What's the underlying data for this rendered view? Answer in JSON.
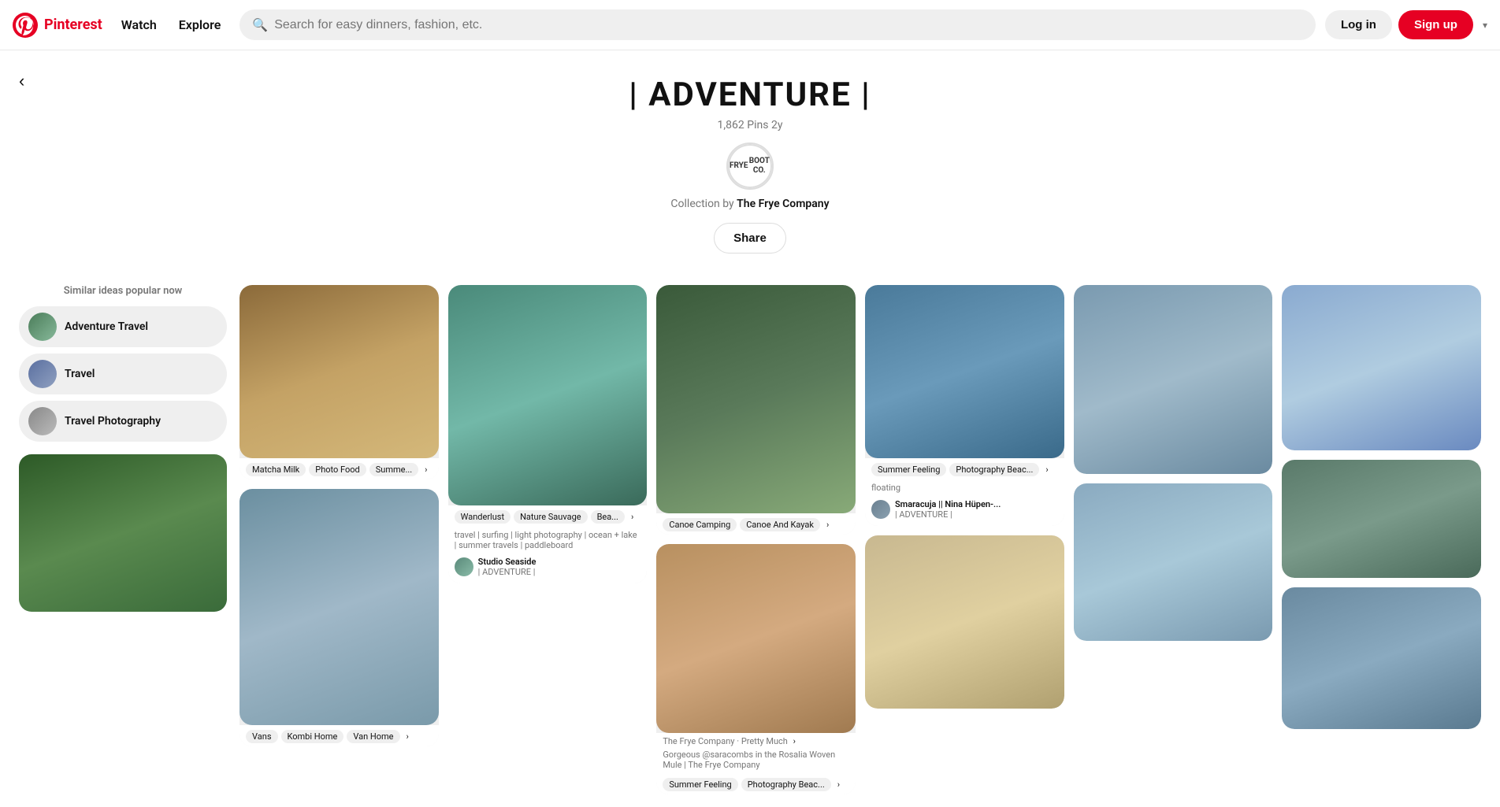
{
  "header": {
    "brand": "Pinterest",
    "nav": [
      {
        "label": "Watch",
        "id": "watch"
      },
      {
        "label": "Explore",
        "id": "explore"
      }
    ],
    "search_placeholder": "Search for easy dinners, fashion, etc.",
    "login_label": "Log in",
    "signup_label": "Sign up"
  },
  "board": {
    "title": "| ADVENTURE |",
    "pins_count": "1,862",
    "pins_label": "Pins",
    "age": "2y",
    "collection_prefix": "Collection by",
    "collection_author": "The Frye Company",
    "share_label": "Share",
    "frye_logo_line1": "FRYE",
    "frye_logo_line2": "BOOT CO."
  },
  "sidebar": {
    "similar_title": "Similar ideas popular now",
    "tags": [
      {
        "label": "Adventure Travel",
        "id": "adventure-travel"
      },
      {
        "label": "Travel",
        "id": "travel"
      },
      {
        "label": "Travel Photography",
        "id": "travel-photography"
      }
    ]
  },
  "pins": [
    {
      "id": "pin-food",
      "style": "ph-food",
      "tags": [
        "Matcha Milk",
        "Photo Food",
        "Summe..."
      ],
      "has_more": true,
      "col": 1
    },
    {
      "id": "pin-van",
      "style": "ph-van",
      "tags": [
        "Vans",
        "Kombi Home",
        "Van Home"
      ],
      "has_more": true,
      "col": 2
    },
    {
      "id": "pin-water",
      "style": "ph-water",
      "tags": [
        "Wanderlust",
        "Nature Sauvage",
        "Bea..."
      ],
      "has_more": true,
      "desc": "travel | surfing | light photography | ocean + lake | summer travels | paddleboard",
      "user_name": "Studio Seaside",
      "user_sub": "| ADVENTURE |",
      "col": 3
    },
    {
      "id": "pin-canoe",
      "style": "ph-canoe",
      "tags": [
        "Canoe Camping",
        "Canoe And Kayak"
      ],
      "has_more": true,
      "col": 4
    },
    {
      "id": "pin-cactus",
      "style": "ph-cactus",
      "category": "The Frye Company · Pretty Much",
      "desc": "Gorgeous @saracombs in the Rosalia Woven Mule | The Frye Company",
      "tags": [
        "Summer Feeling",
        "Photography Beac..."
      ],
      "has_more": true,
      "col": 5
    },
    {
      "id": "pin-boat",
      "style": "ph-boat",
      "tags": [
        "Summer Feeling",
        "Photography Beac..."
      ],
      "has_more": true,
      "col": 6
    },
    {
      "id": "pin-picnic",
      "style": "ph-picnic",
      "col": 1
    },
    {
      "id": "pin-rock",
      "style": "ph-rock",
      "col": 2
    },
    {
      "id": "pin-ice",
      "style": "ph-ice",
      "col": 3
    },
    {
      "id": "pin-swim",
      "style": "ph-swim",
      "desc": "floating",
      "user_name": "Smaracuja || Nina Hüpen-...",
      "user_sub": "| ADVENTURE |",
      "col": 6
    },
    {
      "id": "pin-cloud",
      "style": "ph-cloud",
      "col": 5
    },
    {
      "id": "pin-tent",
      "style": "ph-tent",
      "col": 3
    },
    {
      "id": "pin-mountain",
      "style": "ph-mountain",
      "col": 4
    }
  ]
}
